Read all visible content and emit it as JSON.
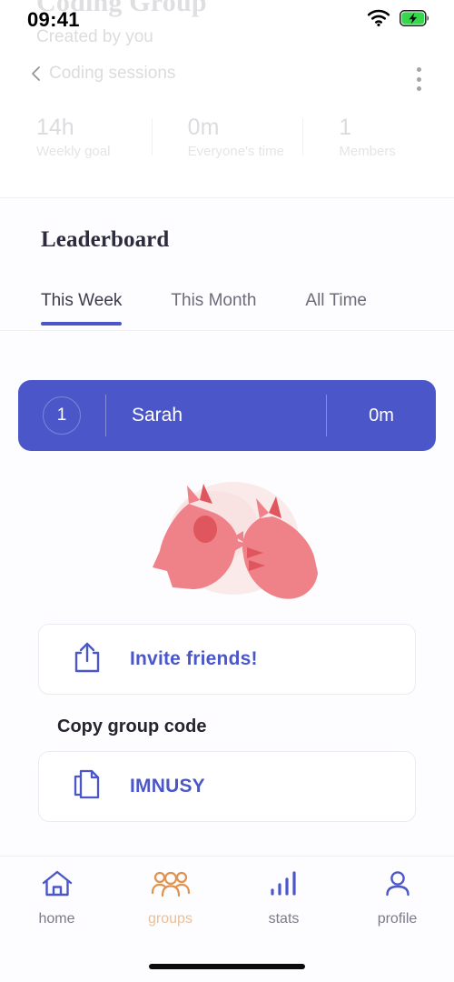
{
  "status_bar": {
    "time": "09:41",
    "wifi_icon": "wifi-icon",
    "battery_icon": "battery-charging-icon"
  },
  "header": {
    "group_title": "Coding Group",
    "created_by": "Created by you",
    "back_label": "Coding sessions",
    "back_icon": "chevron-left-icon",
    "menu_icon": "kebab-menu-icon",
    "stats": [
      {
        "value": "14h",
        "label": "Weekly goal"
      },
      {
        "value": "0m",
        "label": "Everyone's time"
      },
      {
        "value": "1",
        "label": "Members"
      }
    ]
  },
  "leaderboard": {
    "title": "Leaderboard",
    "tabs": [
      {
        "label": "This Week",
        "active": true
      },
      {
        "label": "This Month",
        "active": false
      },
      {
        "label": "All Time",
        "active": false
      }
    ],
    "rows": [
      {
        "rank": "1",
        "name": "Sarah",
        "time": "0m"
      }
    ]
  },
  "illustration": {
    "name": "dog-and-cat-illustration"
  },
  "invite": {
    "label": "Invite friends!",
    "icon": "share-icon"
  },
  "group_code": {
    "section_label": "Copy group code",
    "code": "IMNUSY",
    "icon": "copy-icon"
  },
  "bottom_nav": {
    "items": [
      {
        "label": "home",
        "icon": "home-icon",
        "active": false
      },
      {
        "label": "groups",
        "icon": "people-icon",
        "active": true
      },
      {
        "label": "stats",
        "icon": "bar-chart-icon",
        "active": false
      },
      {
        "label": "profile",
        "icon": "person-icon",
        "active": false
      }
    ]
  },
  "colors": {
    "accent_blue": "#4b57c9",
    "accent_orange": "#e0924f",
    "background": "#fdfcfe",
    "illustration_pink": "#ef8189",
    "battery_green": "#35d74b"
  }
}
